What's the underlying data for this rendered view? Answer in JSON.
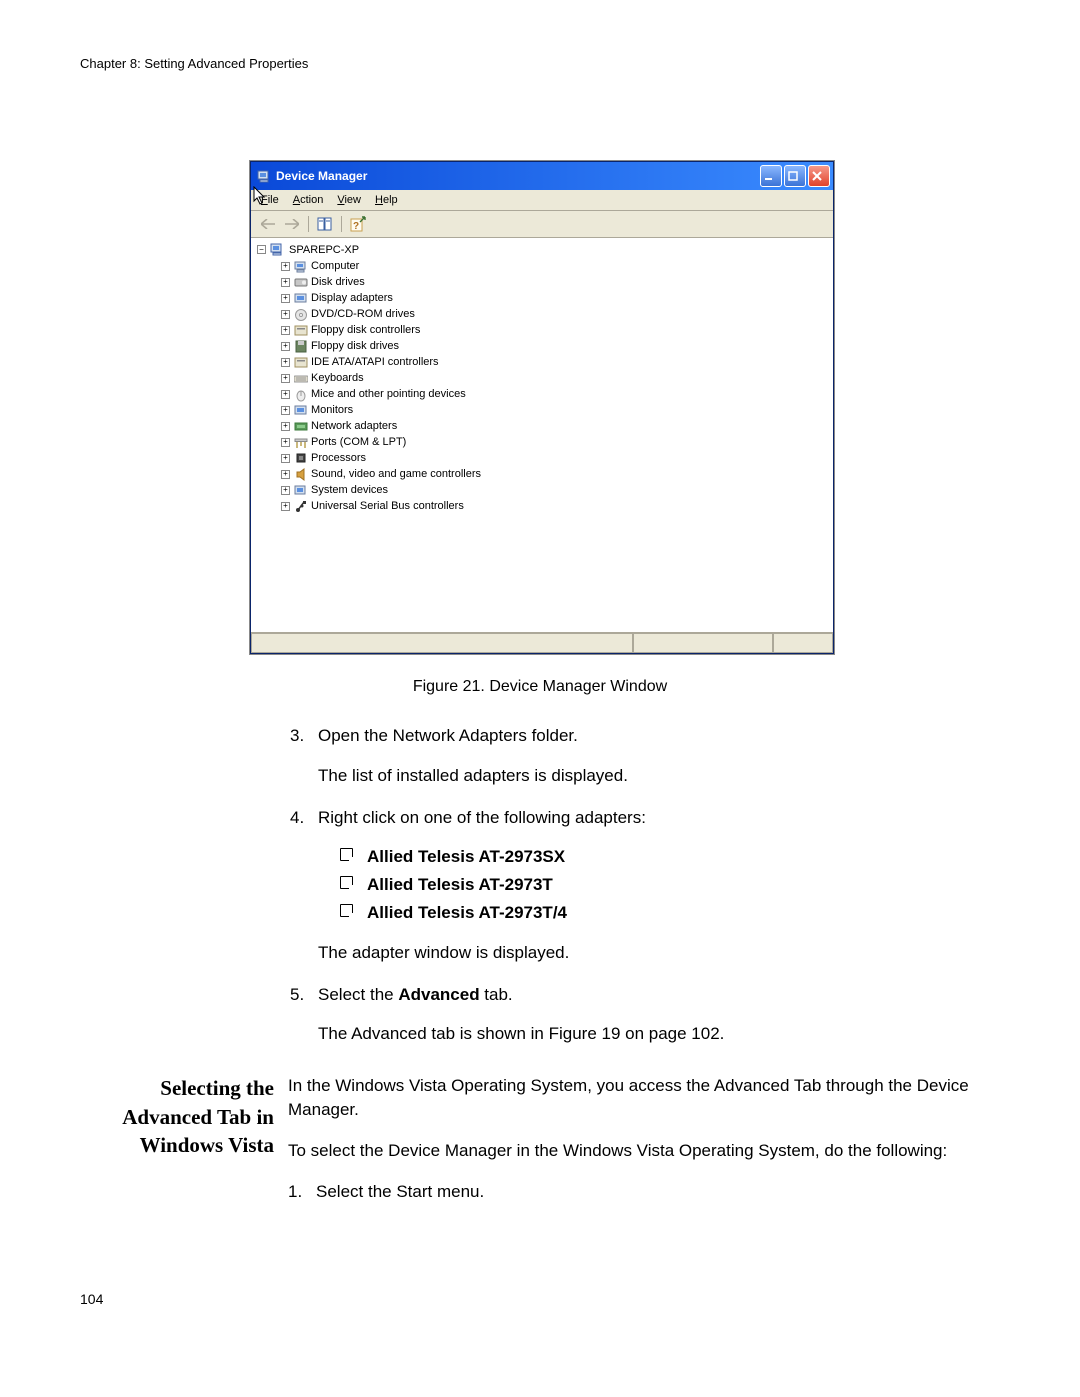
{
  "header": {
    "chapter": "Chapter 8: Setting Advanced Properties"
  },
  "window": {
    "title": "Device Manager",
    "menu": {
      "file": "File",
      "action": "Action",
      "view": "View",
      "help": "Help"
    },
    "root_label": "SPAREPC-XP",
    "nodes": [
      {
        "label": "Computer",
        "icon": "computer"
      },
      {
        "label": "Disk drives",
        "icon": "disk"
      },
      {
        "label": "Display adapters",
        "icon": "display"
      },
      {
        "label": "DVD/CD-ROM drives",
        "icon": "dvd"
      },
      {
        "label": "Floppy disk controllers",
        "icon": "floppy-ctrl"
      },
      {
        "label": "Floppy disk drives",
        "icon": "floppy"
      },
      {
        "label": "IDE ATA/ATAPI controllers",
        "icon": "ide"
      },
      {
        "label": "Keyboards",
        "icon": "keyboard"
      },
      {
        "label": "Mice and other pointing devices",
        "icon": "mouse"
      },
      {
        "label": "Monitors",
        "icon": "monitor"
      },
      {
        "label": "Network adapters",
        "icon": "network"
      },
      {
        "label": "Ports (COM & LPT)",
        "icon": "port"
      },
      {
        "label": "Processors",
        "icon": "cpu"
      },
      {
        "label": "Sound, video and game controllers",
        "icon": "sound"
      },
      {
        "label": "System devices",
        "icon": "system"
      },
      {
        "label": "Universal Serial Bus controllers",
        "icon": "usb"
      }
    ]
  },
  "caption": "Figure 21. Device Manager Window",
  "steps": {
    "s3_num": "3.",
    "s3_t1": "Open the Network Adapters folder.",
    "s3_t2": "The list of installed adapters is displayed.",
    "s4_num": "4.",
    "s4_t1": "Right click on one of the following adapters:",
    "s4_t2": "The adapter window is displayed.",
    "s5_num": "5.",
    "s5_t1_a": "Select the ",
    "s5_t1_b": "Advanced",
    "s5_t1_c": " tab.",
    "s5_t2": "The Advanced tab is shown in Figure 19 on page 102.",
    "adapters": [
      "Allied Telesis AT-2973SX",
      "Allied Telesis AT-2973T",
      "Allied Telesis AT-2973T/4"
    ]
  },
  "section": {
    "heading_l1": "Selecting the",
    "heading_l2": "Advanced Tab in",
    "heading_l3": "Windows Vista",
    "p1": "In the Windows Vista Operating System, you access the Advanced Tab through the Device Manager.",
    "p2": "To select the Device Manager in the Windows Vista Operating System, do the following:",
    "step1_num": "1.",
    "step1_text": "Select the Start menu."
  },
  "page_number": "104"
}
